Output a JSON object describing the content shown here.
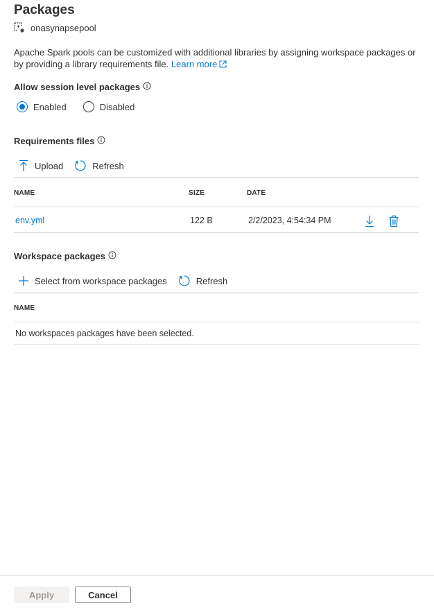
{
  "header": {
    "title": "Packages",
    "resource_name": "onasynapsepool"
  },
  "description": {
    "text": "Apache Spark pools can be customized with additional libraries by assigning workspace packages or by providing a library requirements file.",
    "learn_more": "Learn more"
  },
  "session_packages": {
    "label": "Allow session level packages",
    "options": [
      {
        "label": "Enabled",
        "selected": true
      },
      {
        "label": "Disabled",
        "selected": false
      }
    ]
  },
  "requirements_files": {
    "label": "Requirements files",
    "toolbar": {
      "upload": "Upload",
      "refresh": "Refresh"
    },
    "columns": {
      "name": "NAME",
      "size": "SIZE",
      "date": "DATE"
    },
    "rows": [
      {
        "name": "env.yml",
        "size": "122 B",
        "date": "2/2/2023, 4:54:34 PM"
      }
    ]
  },
  "workspace_packages": {
    "label": "Workspace packages",
    "toolbar": {
      "select": "Select from workspace packages",
      "refresh": "Refresh"
    },
    "columns": {
      "name": "NAME"
    },
    "empty_message": "No workspaces packages have been selected."
  },
  "footer": {
    "apply": "Apply",
    "cancel": "Cancel"
  },
  "colors": {
    "accent": "#0078d4",
    "text": "#323130",
    "disabled_bg": "#f3f2f1",
    "disabled_text": "#a19f9d"
  },
  "icons": {
    "resource": "spark-pool-icon",
    "info": "info-icon",
    "external": "external-link-icon",
    "upload": "upload-icon",
    "refresh": "refresh-icon",
    "download": "download-icon",
    "delete": "trash-icon",
    "add": "plus-icon"
  }
}
